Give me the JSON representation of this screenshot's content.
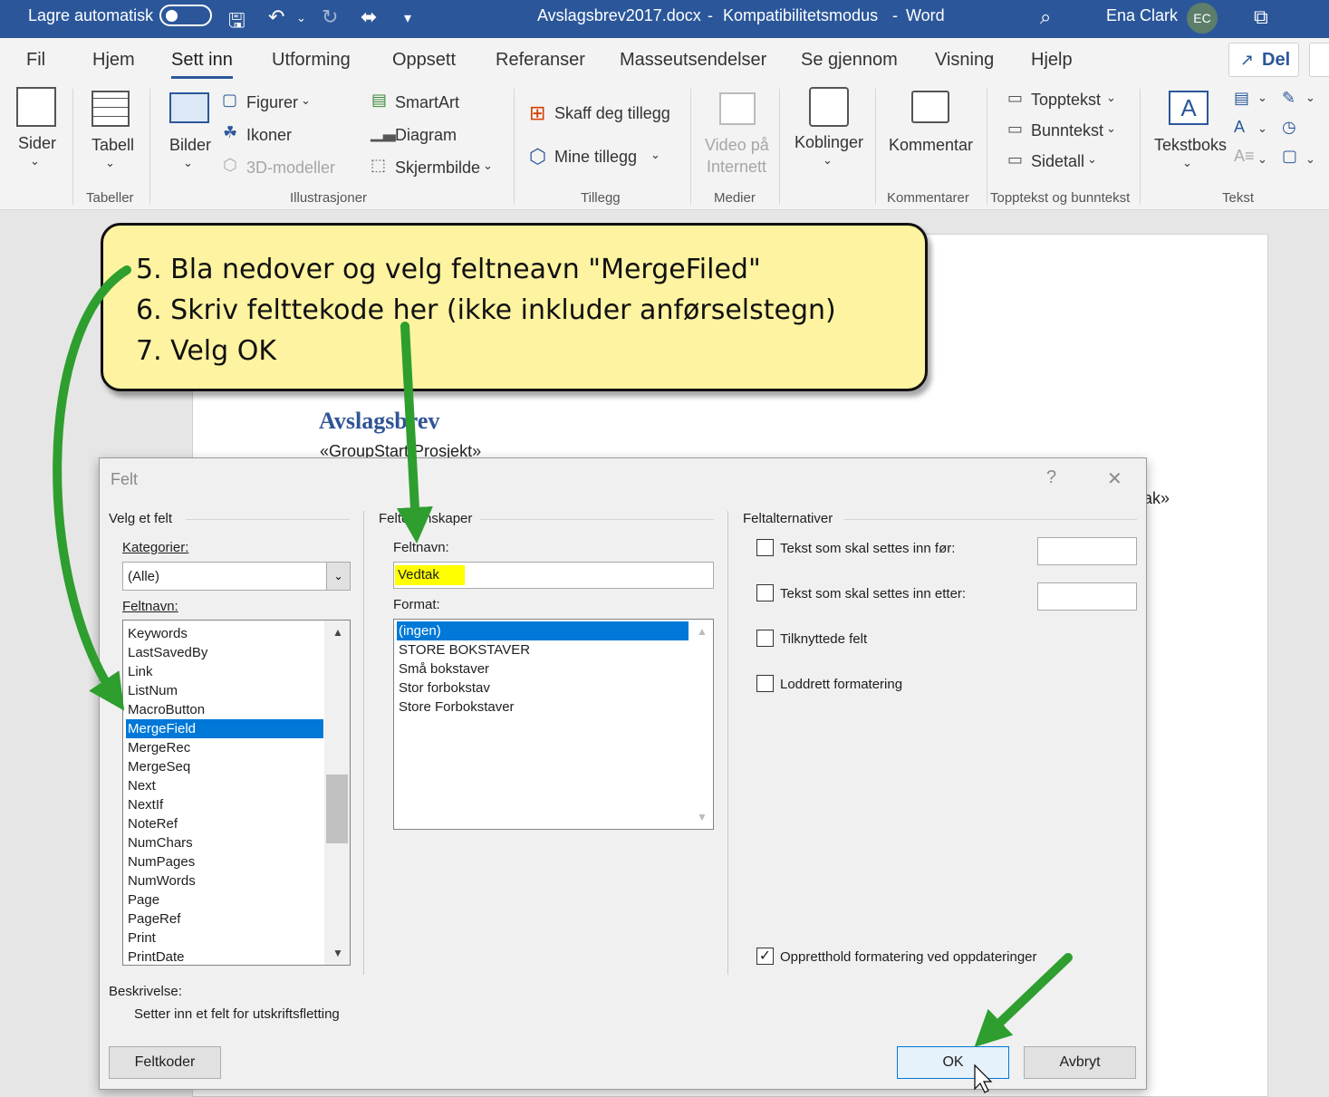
{
  "titlebar": {
    "autosave_label": "Lagre automatisk",
    "filename": "Avslagsbrev2017.docx",
    "sep1": "-",
    "mode": "Kompatibilitetsmodus",
    "sep2": "-",
    "app": "Word",
    "user_name": "Ena Clark",
    "user_initials": "EC"
  },
  "tabs": [
    {
      "label": "Fil"
    },
    {
      "label": "Hjem"
    },
    {
      "label": "Sett inn"
    },
    {
      "label": "Utforming"
    },
    {
      "label": "Oppsett"
    },
    {
      "label": "Referanser"
    },
    {
      "label": "Masseutsendelser"
    },
    {
      "label": "Se gjennom"
    },
    {
      "label": "Visning"
    },
    {
      "label": "Hjelp"
    }
  ],
  "share_label": "Del",
  "ribbon": {
    "sider": "Sider",
    "tabell": "Tabell",
    "tabeller_group": "Tabeller",
    "bilder": "Bilder",
    "figurer": "Figurer",
    "ikoner": "Ikoner",
    "modeller3d": "3D-modeller",
    "smartart": "SmartArt",
    "diagram": "Diagram",
    "skjermbilde": "Skjermbilde",
    "illustrasjoner_group": "Illustrasjoner",
    "skaff": "Skaff deg tillegg",
    "mine": "Mine tillegg",
    "tillegg_group": "Tillegg",
    "video1": "Video på",
    "video2": "Internett",
    "medier_group": "Medier",
    "koblinger": "Koblinger",
    "kommentar": "Kommentar",
    "kommentarer_group": "Kommentarer",
    "topptekst": "Topptekst",
    "bunntekst": "Bunntekst",
    "sidetall": "Sidetall",
    "topp_group": "Topptekst og bunntekst",
    "tekstboks": "Tekstboks",
    "tekst_group": "Tekst"
  },
  "document": {
    "heading": "Avslagsbrev",
    "group_start": "«GroupStart:Prosjekt»",
    "fragment": "ak»"
  },
  "callout": {
    "line1": "5. Bla nedover og velg feltneavn \"MergeFiled\"",
    "line2": "6. Skriv felttekode her (ikke inkluder anførselstegn)",
    "line3": "7. Velg OK"
  },
  "dialog": {
    "title": "Felt",
    "help_glyph": "?",
    "close_glyph": "✕",
    "choose_field": "Velg et felt",
    "categories_label": "Kategorier:",
    "category_value": "(Alle)",
    "field_names_label": "Feltnavn:",
    "field_names": [
      "Keywords",
      "LastSavedBy",
      "Link",
      "ListNum",
      "MacroButton",
      "MergeField",
      "MergeRec",
      "MergeSeq",
      "Next",
      "NextIf",
      "NoteRef",
      "NumChars",
      "NumPages",
      "NumWords",
      "Page",
      "PageRef",
      "Print",
      "PrintDate"
    ],
    "selected_field": "MergeField",
    "field_props_label": "Feltegenskaper",
    "field_name_label": "Feltnavn:",
    "field_name_value": "Vedtak",
    "format_label": "Format:",
    "formats": [
      "(ingen)",
      "STORE BOKSTAVER",
      "Små bokstaver",
      "Stor forbokstav",
      "Store Forbokstaver"
    ],
    "selected_format": "(ingen)",
    "field_options_label": "Feltalternativer",
    "opt_before": "Tekst som skal settes inn før:",
    "opt_after": "Tekst som skal settes inn etter:",
    "opt_linked": "Tilknyttede felt",
    "opt_vertical": "Loddrett formatering",
    "opt_preserve": "Oppretthold formatering ved oppdateringer",
    "opt_preserve_checked": true,
    "description_label": "Beskrivelse:",
    "description_text": "Setter inn et felt for utskriftsfletting",
    "field_codes_button": "Feltkoder",
    "ok_button": "OK",
    "cancel_button": "Avbryt"
  },
  "colors": {
    "titlebar": "#2b579a",
    "callout_fill": "#fdf3a0",
    "arrow": "#2e9e2e",
    "selection": "#0078d7",
    "highlight": "#ffff00"
  }
}
